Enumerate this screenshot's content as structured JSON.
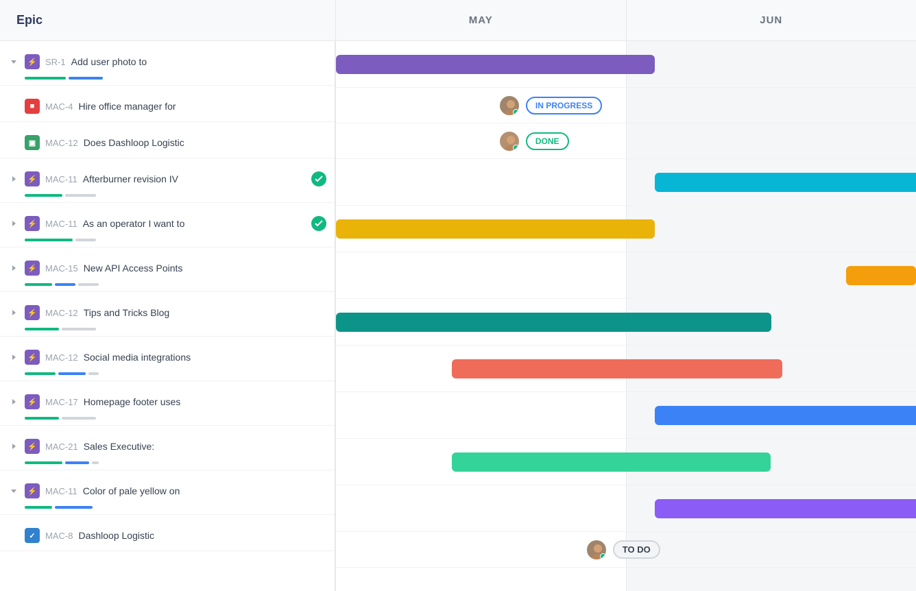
{
  "header": {
    "epic_label": "Epic",
    "months": [
      "MAY",
      "JUN"
    ]
  },
  "rows": [
    {
      "id": "SR-1",
      "title": "Add user photo to",
      "icon_type": "purple",
      "icon_symbol": "⚡",
      "expanded": true,
      "has_progress": true,
      "progress": [
        {
          "color": "#10b981",
          "width": 60
        },
        {
          "color": "#3b82f6",
          "width": 50
        }
      ],
      "gantt": {
        "type": "bar",
        "color": "#7c5cbf",
        "left_pct": 0,
        "width_pct": 55
      },
      "children": [
        {
          "id": "MAC-4",
          "title": "Hire office manager for",
          "icon_type": "red",
          "icon_symbol": "■",
          "has_progress": false,
          "gantt": {
            "type": "avatar-status",
            "avatar_left_pct": 28,
            "status": "IN PROGRESS",
            "status_class": "status-in-progress"
          }
        },
        {
          "id": "MAC-12",
          "title": "Does Dashloop Logistic",
          "icon_type": "green",
          "icon_symbol": "▣",
          "has_progress": false,
          "gantt": {
            "type": "avatar-status",
            "avatar_left_pct": 28,
            "status": "DONE",
            "status_class": "status-done"
          }
        }
      ]
    },
    {
      "id": "MAC-11",
      "title": "Afterburner revision IV",
      "icon_type": "purple",
      "icon_symbol": "⚡",
      "expanded": false,
      "check": true,
      "has_progress": true,
      "progress": [
        {
          "color": "#10b981",
          "width": 55
        },
        {
          "color": "#d1d5db",
          "width": 45
        }
      ],
      "gantt": {
        "type": "bar",
        "color": "#06b6d4",
        "left_pct": 55,
        "width_pct": 55
      }
    },
    {
      "id": "MAC-11",
      "title": "As an operator I want to",
      "icon_type": "purple",
      "icon_symbol": "⚡",
      "expanded": false,
      "check": true,
      "has_progress": true,
      "progress": [
        {
          "color": "#10b981",
          "width": 70
        },
        {
          "color": "#d1d5db",
          "width": 30
        }
      ],
      "gantt": {
        "type": "bar",
        "color": "#eab308",
        "left_pct": 0,
        "width_pct": 55
      }
    },
    {
      "id": "MAC-15",
      "title": "New API Access Points",
      "icon_type": "purple",
      "icon_symbol": "⚡",
      "expanded": false,
      "has_progress": true,
      "progress": [
        {
          "color": "#10b981",
          "width": 40
        },
        {
          "color": "#3b82f6",
          "width": 30
        },
        {
          "color": "#d1d5db",
          "width": 30
        }
      ],
      "gantt": {
        "type": "bar",
        "color": "#f59e0b",
        "left_pct": 88,
        "width_pct": 12
      }
    },
    {
      "id": "MAC-12",
      "title": "Tips and Tricks Blog",
      "icon_type": "purple",
      "icon_symbol": "⚡",
      "expanded": false,
      "has_progress": true,
      "progress": [
        {
          "color": "#10b981",
          "width": 50
        },
        {
          "color": "#d1d5db",
          "width": 50
        }
      ],
      "gantt": {
        "type": "bar",
        "color": "#0d9488",
        "left_pct": 0,
        "width_pct": 75
      }
    },
    {
      "id": "MAC-12",
      "title": "Social media integrations",
      "icon_type": "purple",
      "icon_symbol": "⚡",
      "expanded": false,
      "has_progress": true,
      "progress": [
        {
          "color": "#10b981",
          "width": 45
        },
        {
          "color": "#3b82f6",
          "width": 40
        },
        {
          "color": "#d1d5db",
          "width": 15
        }
      ],
      "gantt": {
        "type": "bar",
        "color": "#ef6c5a",
        "left_pct": 20,
        "width_pct": 57
      }
    },
    {
      "id": "MAC-17",
      "title": "Homepage footer uses",
      "icon_type": "purple",
      "icon_symbol": "⚡",
      "expanded": false,
      "has_progress": true,
      "progress": [
        {
          "color": "#10b981",
          "width": 50
        },
        {
          "color": "#d1d5db",
          "width": 50
        }
      ],
      "gantt": {
        "type": "bar",
        "color": "#3b82f6",
        "left_pct": 55,
        "width_pct": 55
      }
    },
    {
      "id": "MAC-21",
      "title": "Sales Executive:",
      "icon_type": "purple",
      "icon_symbol": "⚡",
      "expanded": false,
      "has_progress": true,
      "progress": [
        {
          "color": "#10b981",
          "width": 55
        },
        {
          "color": "#3b82f6",
          "width": 35
        },
        {
          "color": "#d1d5db",
          "width": 10
        }
      ],
      "gantt": {
        "type": "bar",
        "color": "#34d399",
        "left_pct": 20,
        "width_pct": 55
      }
    },
    {
      "id": "MAC-11",
      "title": "Color of pale yellow on",
      "icon_type": "purple",
      "icon_symbol": "⚡",
      "expanded": true,
      "has_progress": true,
      "progress": [
        {
          "color": "#10b981",
          "width": 40
        },
        {
          "color": "#3b82f6",
          "width": 55
        }
      ],
      "gantt": {
        "type": "bar",
        "color": "#8b5cf6",
        "left_pct": 55,
        "width_pct": 55
      },
      "children": [
        {
          "id": "MAC-8",
          "title": "Dashloop Logistic",
          "icon_type": "blue",
          "icon_symbol": "✓",
          "has_progress": false,
          "gantt": {
            "type": "avatar-status",
            "avatar_left_pct": 43,
            "status": "TO DO",
            "status_class": "status-todo"
          }
        }
      ]
    }
  ]
}
